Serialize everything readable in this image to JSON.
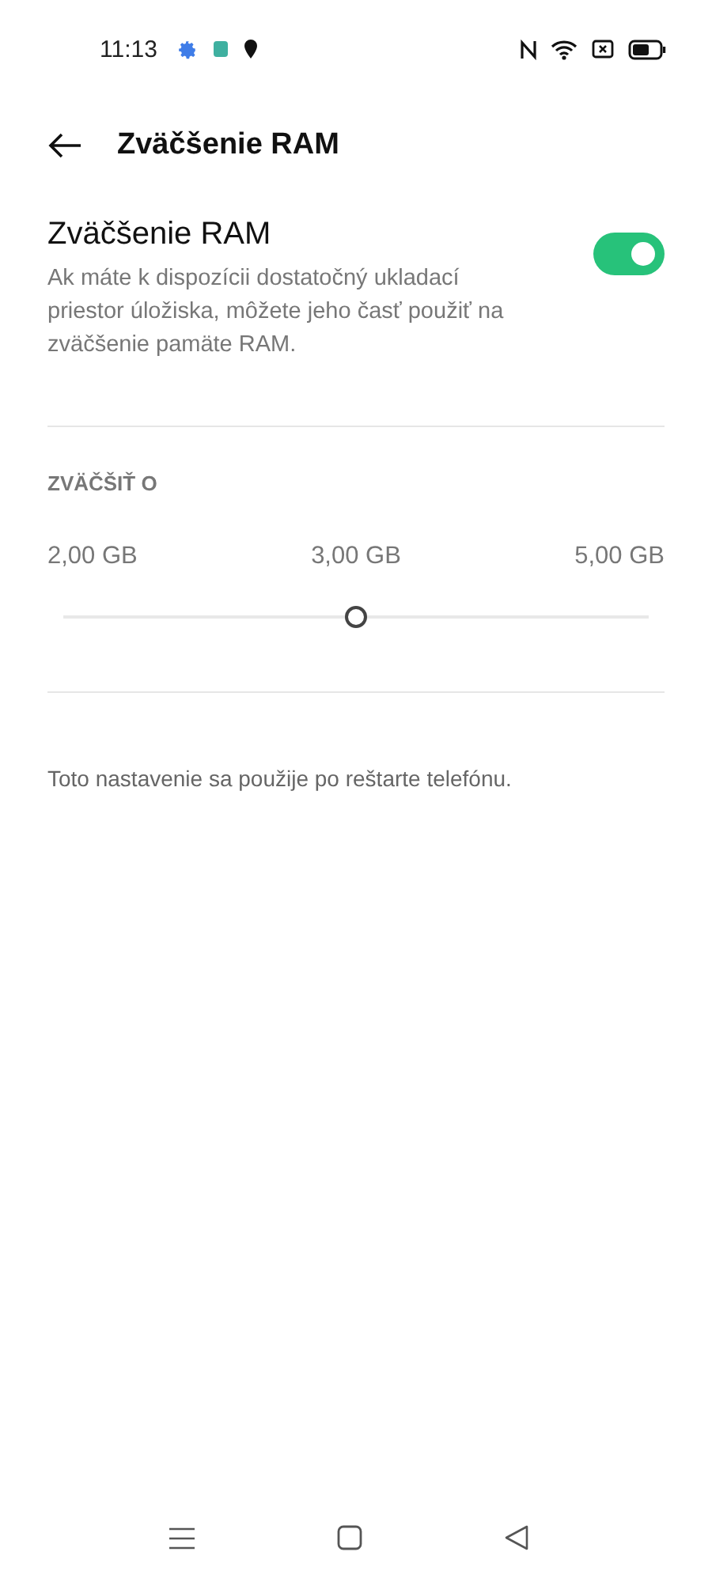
{
  "status_bar": {
    "time": "11:13"
  },
  "header": {
    "title": "Zväčšenie RAM"
  },
  "setting": {
    "title": "Zväčšenie RAM",
    "description": "Ak máte k dispozícii dostatočný ukladací priestor úložiska, môžete jeho časť použiť na zväčšenie pamäte RAM.",
    "on": true
  },
  "section": {
    "label": "ZVÄČŠIŤ O"
  },
  "slider": {
    "stops": [
      "2,00 GB",
      "3,00 GB",
      "5,00 GB"
    ],
    "level": 0.5
  },
  "note": "Toto nastavenie sa použije po reštarte telefónu."
}
